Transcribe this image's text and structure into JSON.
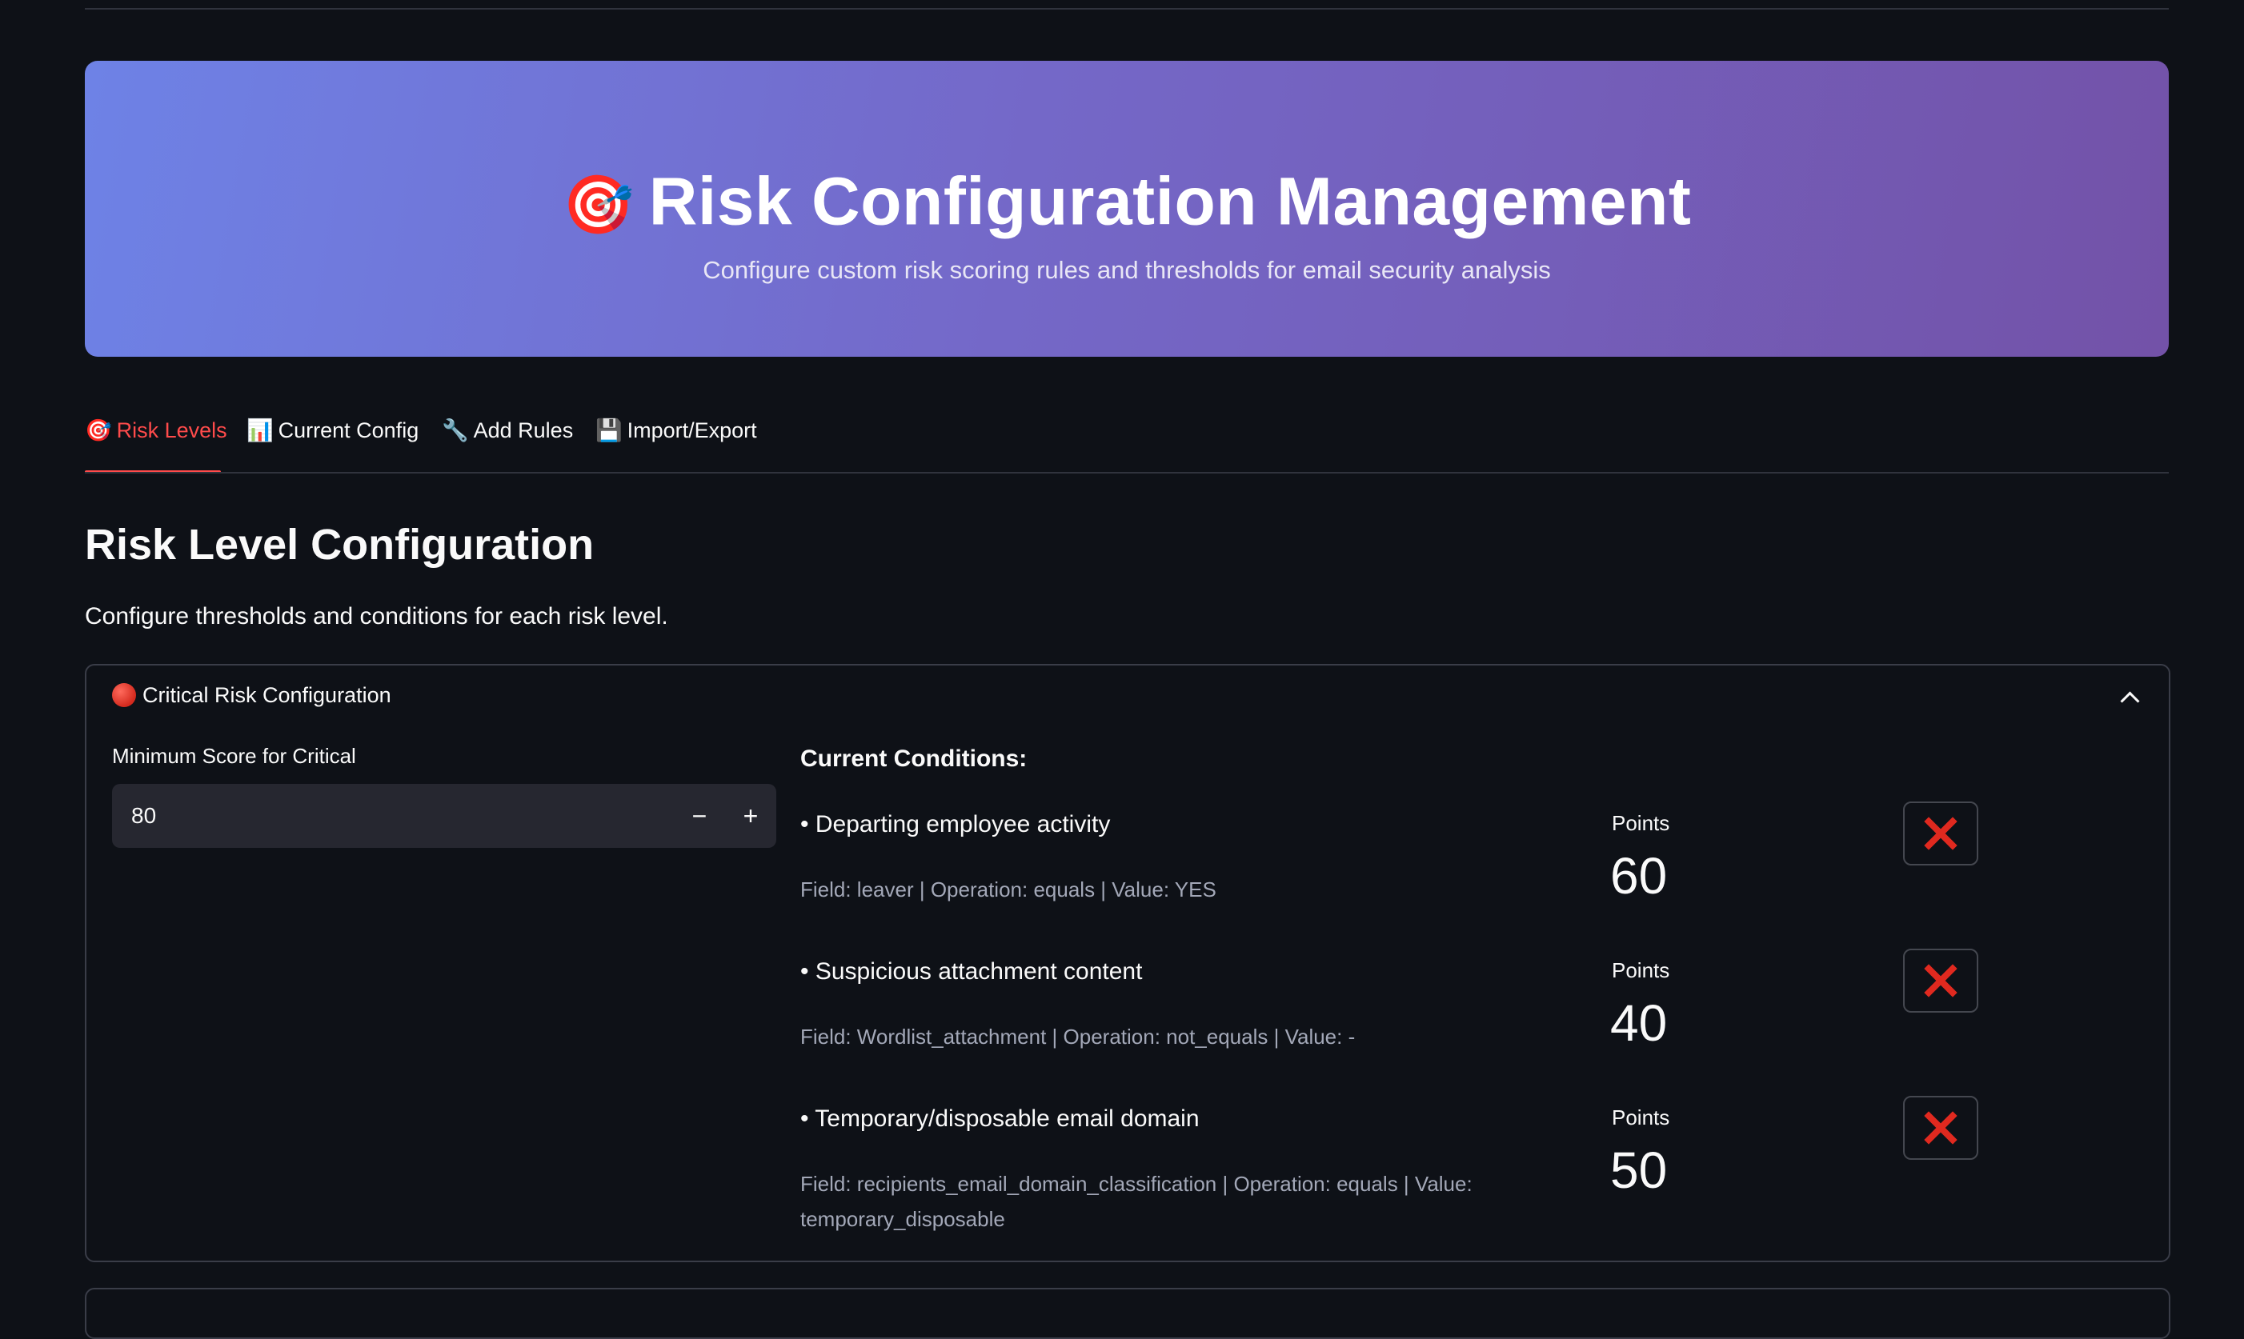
{
  "hero": {
    "emoji": "🎯",
    "title": "Risk Configuration Management",
    "subtitle": "Configure custom risk scoring rules and thresholds for email security analysis"
  },
  "tabs": [
    {
      "icon": "🎯",
      "label": "Risk Levels",
      "active": true
    },
    {
      "icon": "📊",
      "label": "Current Config",
      "active": false
    },
    {
      "icon": "🔧",
      "label": "Add Rules",
      "active": false
    },
    {
      "icon": "💾",
      "label": "Import/Export",
      "active": false
    }
  ],
  "section": {
    "title": "Risk Level Configuration",
    "description": "Configure thresholds and conditions for each risk level."
  },
  "critical": {
    "header": "Critical Risk Configuration",
    "min_score_label": "Minimum Score for Critical",
    "min_score_value": "80",
    "minus": "−",
    "plus": "+",
    "conditions_title": "Current Conditions:",
    "conditions": [
      {
        "name": "• Departing employee activity",
        "meta": "Field: leaver | Operation: equals | Value: YES",
        "points_label": "Points",
        "points": "60"
      },
      {
        "name": "• Suspicious attachment content",
        "meta": "Field: Wordlist_attachment | Operation: not_equals | Value: -",
        "points_label": "Points",
        "points": "40"
      },
      {
        "name": "• Temporary/disposable email domain",
        "meta": "Field: recipients_email_domain_classification | Operation: equals | Value: temporary_disposable",
        "points_label": "Points",
        "points": "50"
      }
    ]
  },
  "colors": {
    "accent": "#ff4b4b",
    "background": "#0e1117",
    "delete_icon": "#e0291f"
  }
}
